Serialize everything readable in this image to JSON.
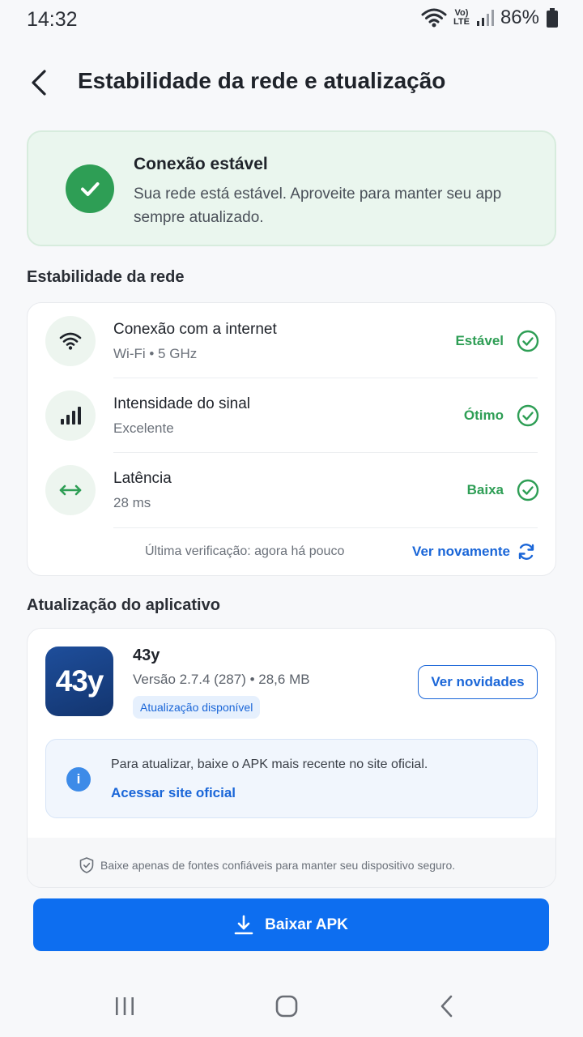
{
  "status_bar": {
    "time": "14:32",
    "battery": "86%",
    "volte_top": "Vo)",
    "volte_bottom": "LTE"
  },
  "header": {
    "title": "Estabilidade da rede e atualização"
  },
  "banner": {
    "title": "Conexão estável",
    "description": "Sua rede está estável. Aproveite para manter seu app sempre atualizado."
  },
  "network": {
    "section_title": "Estabilidade da rede",
    "rows": [
      {
        "label": "Conexão com a internet",
        "sub": "Wi-Fi • 5 GHz",
        "status": "Estável",
        "icon": "wifi-icon"
      },
      {
        "label": "Intensidade do sinal",
        "sub": "Excelente",
        "status": "Ótimo",
        "icon": "signal-bars-icon"
      },
      {
        "label": "Latência",
        "sub": "28 ms",
        "status": "Baixa",
        "icon": "latency-arrows-icon"
      }
    ],
    "last_check": "Última verificação: agora há pouco",
    "recheck_label": "Ver novamente"
  },
  "app_update": {
    "section_title": "Atualização do aplicativo",
    "logo_text": "43y",
    "name": "43y",
    "version": "Versão 2.7.4 (287) • 28,6 MB",
    "badge": "Atualização disponível",
    "news_button": "Ver novidades",
    "info_text": "Para atualizar, baixe o APK mais recente no site oficial.",
    "info_link": "Acessar site oficial",
    "safety_note": "Baixe apenas de fontes confiáveis para manter seu dispositivo seguro."
  },
  "download_button": "Baixar APK",
  "colors": {
    "accent": "#0d6ef0",
    "success": "#2e9e55",
    "link": "#1a66d8"
  }
}
